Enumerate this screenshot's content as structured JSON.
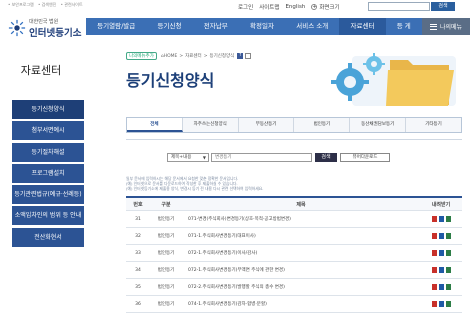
{
  "util": {
    "left_links": [
      "• 보안프로그램",
      "• 검색엔진",
      "• 관련사이트"
    ],
    "login": "로그인",
    "sitemap": "사이트맵",
    "english": "English",
    "zoom_label": "화면크기",
    "search_placeholder": "",
    "search_button": "검색"
  },
  "logo": {
    "small": "대한민국 법원",
    "big": "인터넷등기소"
  },
  "nav": {
    "items": [
      "등기열람/발급",
      "등기신청",
      "전자납부",
      "확정일자",
      "서비스 소개",
      "자료센터",
      "등 게"
    ],
    "my_menu": "나의메뉴"
  },
  "sidebar": {
    "title": "자료센터",
    "items": [
      "등기신청양식",
      "첨부서면예시",
      "등기절차해설",
      "프로그램설치",
      "등기관련법규(예규·선례등)",
      "소액임차인의 범위 등 안내",
      "전산화현서"
    ]
  },
  "breadcrumb": {
    "tag": "나의메뉴추가",
    "home": "HOME",
    "section": "자료센터",
    "current": "등기신청양식",
    "fb": "f"
  },
  "page": {
    "title": "등기신청양식"
  },
  "tabs": [
    "전체",
    "자주쓰는신청양식",
    "부동산등기",
    "법인등기",
    "동산채권담보등기",
    "기타등기"
  ],
  "search": {
    "select_value": "제목+내용",
    "keyword_placeholder": "변경등기",
    "search_button": "검색",
    "viewer_button": "뷰어다운로드"
  },
  "notices": [
    "일부 문서에 입력하시는 해당 문서에서 요청한 맞춘 정확한 문서입니다.",
    "(예) 인터넷으로 문서를 다운로드하여 작성한 후 제출하실 수 있습니다.",
    "(예) 인터넷등기소에 제출용 양식, 변경시 등기 전 내용 다시 관련 선택하여 입력하세요."
  ],
  "table": {
    "headers": [
      "번호",
      "구분",
      "제목",
      "내려받기"
    ],
    "rows": [
      {
        "no": "31",
        "type": "법인등기",
        "title": "071-변경(주식회사)변경등기(상호·목적·공고방법변경)"
      },
      {
        "no": "32",
        "type": "법인등기",
        "title": "071-1.주식회사변경등기(대표이사)"
      },
      {
        "no": "33",
        "type": "법인등기",
        "title": "072-1.주식회사변경등기(이사/감사)"
      },
      {
        "no": "34",
        "type": "법인등기",
        "title": "072-1.주식회사변경등기(무액면 주식에 관한 변경)"
      },
      {
        "no": "35",
        "type": "법인등기",
        "title": "072-2.주식회사변경등기(발행할 주식의 총수 변경)"
      },
      {
        "no": "36",
        "type": "법인등기",
        "title": "074-1.주식회사변경등기(감자·합병·분할)"
      }
    ]
  },
  "colors": {
    "nav": "#3b6fb5",
    "sidebar": "#2c5394",
    "title": "#1c3f78"
  }
}
